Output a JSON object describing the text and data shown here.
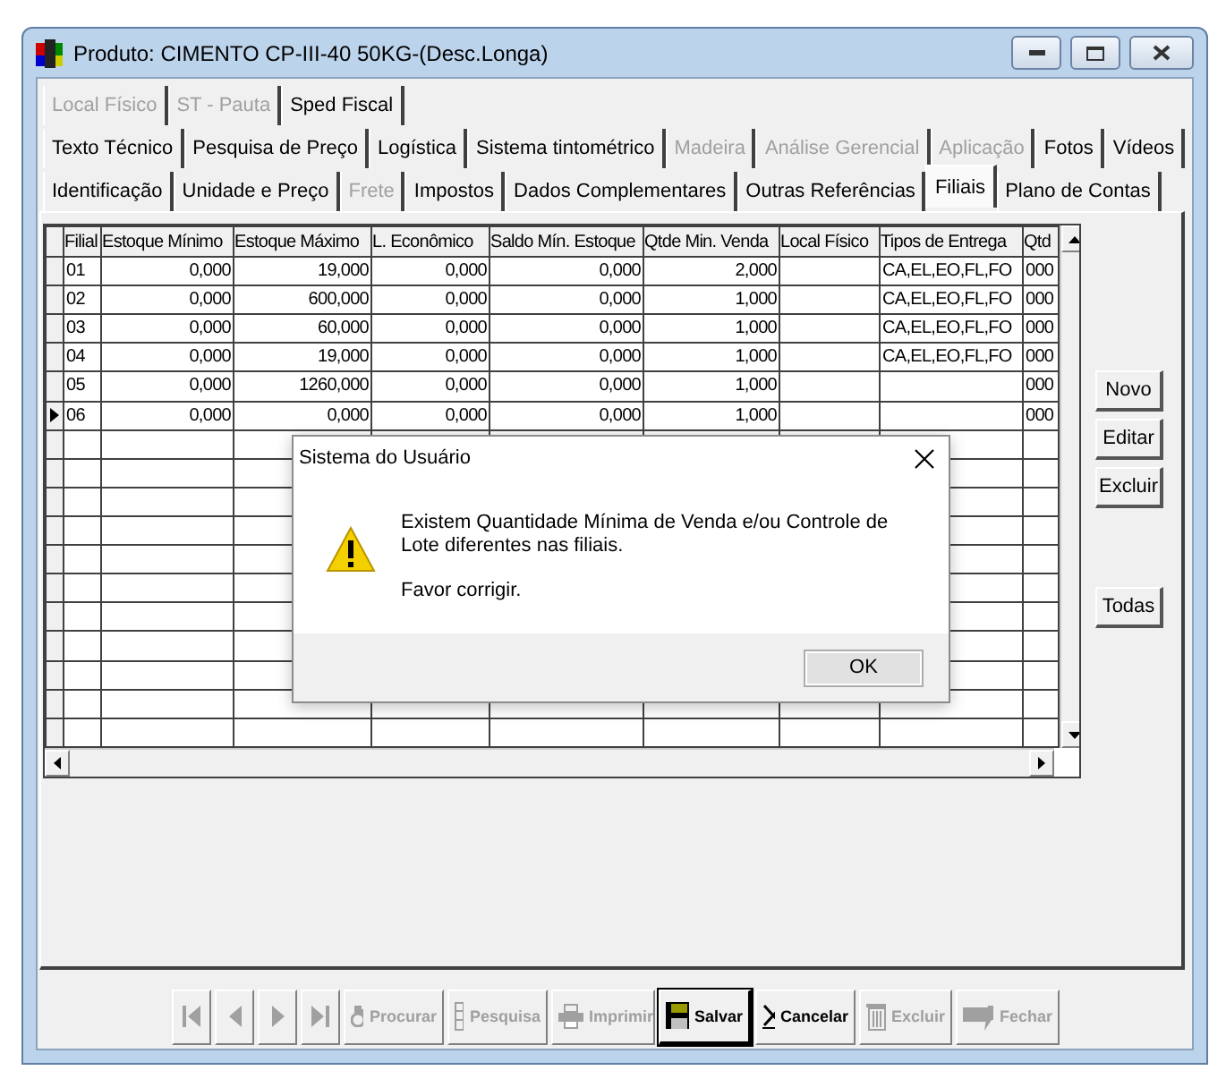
{
  "window": {
    "title": "Produto: CIMENTO CP-III-40 50KG-(Desc.Longa)"
  },
  "tab_rows": [
    [
      {
        "label": "Local Físico",
        "disabled": true,
        "selected": false
      },
      {
        "label": "ST - Pauta",
        "disabled": true,
        "selected": false
      },
      {
        "label": "Sped Fiscal",
        "disabled": false,
        "selected": false
      }
    ],
    [
      {
        "label": "Texto Técnico",
        "disabled": false,
        "selected": false
      },
      {
        "label": "Pesquisa de Preço",
        "disabled": false,
        "selected": false
      },
      {
        "label": "Logística",
        "disabled": false,
        "selected": false
      },
      {
        "label": "Sistema tintométrico",
        "disabled": false,
        "selected": false
      },
      {
        "label": "Madeira",
        "disabled": true,
        "selected": false
      },
      {
        "label": "Análise Gerencial",
        "disabled": true,
        "selected": false
      },
      {
        "label": "Aplicação",
        "disabled": true,
        "selected": false
      },
      {
        "label": "Fotos",
        "disabled": false,
        "selected": false
      },
      {
        "label": "Vídeos",
        "disabled": false,
        "selected": false
      }
    ],
    [
      {
        "label": "Identificação",
        "disabled": false,
        "selected": false
      },
      {
        "label": "Unidade e Preço",
        "disabled": false,
        "selected": false
      },
      {
        "label": "Frete",
        "disabled": true,
        "selected": false
      },
      {
        "label": "Impostos",
        "disabled": false,
        "selected": false
      },
      {
        "label": "Dados Complementares",
        "disabled": false,
        "selected": false
      },
      {
        "label": "Outras Referências",
        "disabled": false,
        "selected": false
      },
      {
        "label": "Filiais",
        "disabled": false,
        "selected": true
      },
      {
        "label": "Plano de Contas",
        "disabled": false,
        "selected": false
      }
    ]
  ],
  "grid": {
    "columns": [
      "Filial",
      "Estoque Mínimo",
      "Estoque Máximo",
      "L. Econômico",
      "Saldo Mín. Estoque",
      "Qtde Min. Venda",
      "Local Físico",
      "Tipos de Entrega",
      "Qtd"
    ],
    "rows": [
      {
        "selected": false,
        "cells": [
          "01",
          "0,000",
          "19,000",
          "0,000",
          "0,000",
          "2,000",
          "",
          "CA,EL,EO,FL,FO",
          "000"
        ]
      },
      {
        "selected": false,
        "cells": [
          "02",
          "0,000",
          "600,000",
          "0,000",
          "0,000",
          "1,000",
          "",
          "CA,EL,EO,FL,FO",
          "000"
        ]
      },
      {
        "selected": false,
        "cells": [
          "03",
          "0,000",
          "60,000",
          "0,000",
          "0,000",
          "1,000",
          "",
          "CA,EL,EO,FL,FO",
          "000"
        ]
      },
      {
        "selected": false,
        "cells": [
          "04",
          "0,000",
          "19,000",
          "0,000",
          "0,000",
          "1,000",
          "",
          "CA,EL,EO,FL,FO",
          "000"
        ]
      },
      {
        "selected": false,
        "cells": [
          "05",
          "0,000",
          "1260,000",
          "0,000",
          "0,000",
          "1,000",
          "",
          "",
          "000"
        ]
      },
      {
        "selected": true,
        "cells": [
          "06",
          "0,000",
          "0,000",
          "0,000",
          "0,000",
          "1,000",
          "",
          "",
          "000"
        ]
      }
    ]
  },
  "side_buttons": [
    "Novo",
    "Editar",
    "Excluir",
    "Todas"
  ],
  "dialog": {
    "title": "Sistema do Usuário",
    "message": "Existem Quantidade Mínima de Venda e/ou Controle de Lote diferentes nas filiais.",
    "note": "Favor corrigir.",
    "button": "OK"
  },
  "toolbar": [
    {
      "kind": "first",
      "disabled": true,
      "focused": false
    },
    {
      "kind": "prev",
      "disabled": true,
      "focused": false
    },
    {
      "kind": "next",
      "disabled": true,
      "focused": false
    },
    {
      "kind": "last",
      "disabled": true,
      "focused": false
    },
    {
      "kind": "search",
      "label": "Procurar",
      "disabled": true,
      "focused": false
    },
    {
      "kind": "grid",
      "label": "Pesquisa",
      "disabled": true,
      "focused": false
    },
    {
      "kind": "print",
      "label": "Imprimir",
      "disabled": true,
      "focused": false
    },
    {
      "kind": "save",
      "label": "Salvar",
      "disabled": false,
      "focused": true
    },
    {
      "kind": "cancel",
      "label": "Cancelar",
      "disabled": false,
      "focused": false
    },
    {
      "kind": "delete",
      "label": "Excluir",
      "disabled": true,
      "focused": false
    },
    {
      "kind": "close",
      "label": "Fechar",
      "disabled": true,
      "focused": false
    }
  ]
}
